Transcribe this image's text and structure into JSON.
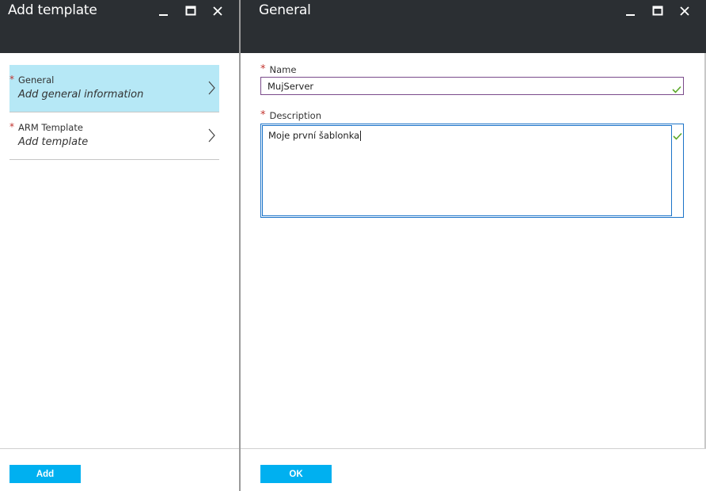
{
  "left_blade": {
    "title": "Add template",
    "menu": [
      {
        "required": "*",
        "title": "General",
        "subtitle": "Add general information",
        "active": true
      },
      {
        "required": "*",
        "title": "ARM Template",
        "subtitle": "Add template",
        "active": false
      }
    ],
    "add_button": "Add"
  },
  "right_blade": {
    "title": "General",
    "name_field": {
      "required": "*",
      "label": "Name",
      "value": "MujServer"
    },
    "description_field": {
      "required": "*",
      "label": "Description",
      "value": "Moje první šablonka"
    },
    "ok_button": "OK"
  },
  "icons": {
    "minimize": "minimize-icon",
    "maximize": "maximize-icon",
    "close": "close-icon",
    "chevron": "chevron-right-icon",
    "check": "check-icon"
  },
  "colors": {
    "header_bg": "#2b2f33",
    "active_item": "#b6e8f6",
    "accent_button": "#00b0f0",
    "required_star": "#c2332e",
    "valid_check": "#5ba829"
  }
}
